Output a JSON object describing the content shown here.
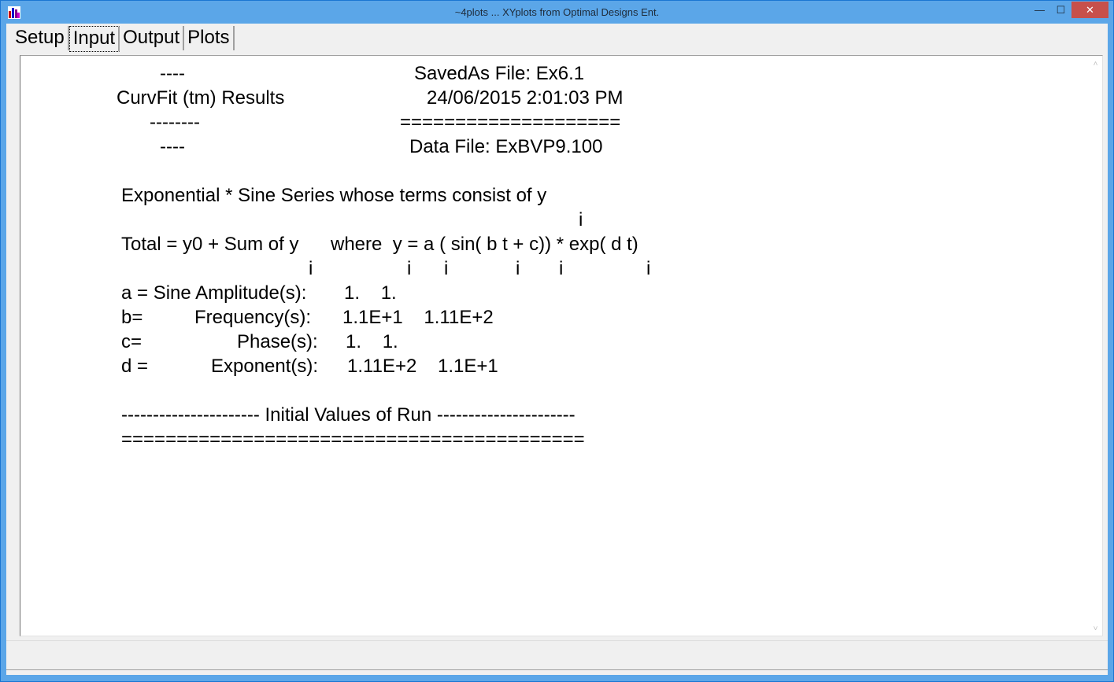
{
  "window": {
    "title": "~4plots ... XYplots from Optimal Designs Ent.",
    "minimize_glyph": "—",
    "maximize_glyph": "☐",
    "close_glyph": "✕"
  },
  "tabs": [
    "Setup",
    "Input",
    "Output",
    "Plots"
  ],
  "active_tab": "Input",
  "output": {
    "dash1": "----",
    "saved_as": "SavedAs File: Ex6.1",
    "results_title": "CurvFit (tm) Results",
    "timestamp": "24/06/2015 2:01:03 PM",
    "dash2": "--------",
    "equals_line": "====================",
    "dash3": "----",
    "data_file": "Data File: ExBVP9.100",
    "series_desc": "Exponential * Sine Series whose terms consist of y",
    "sub_i": "i",
    "total_left": "Total = y0 + Sum of y",
    "total_right": "where  y = a ( sin( b t + c)) * exp( d t)",
    "a_label": "a = Sine Amplitude(s):",
    "a_values": "1.    1.",
    "b_label": "b=",
    "b_name": "Frequency(s):",
    "b_values": "1.1E+1    1.11E+2",
    "c_label": "c=",
    "c_name": "Phase(s):",
    "c_values": "1.    1.",
    "d_label": "d =",
    "d_name": "Exponent(s):",
    "d_values": "1.11E+2    1.1E+1",
    "initial_values": "---------------------- Initial Values of Run ----------------------",
    "final_equals": "=========================================="
  },
  "scrollbar": {
    "up_glyph": "˄",
    "down_glyph": "˅"
  }
}
